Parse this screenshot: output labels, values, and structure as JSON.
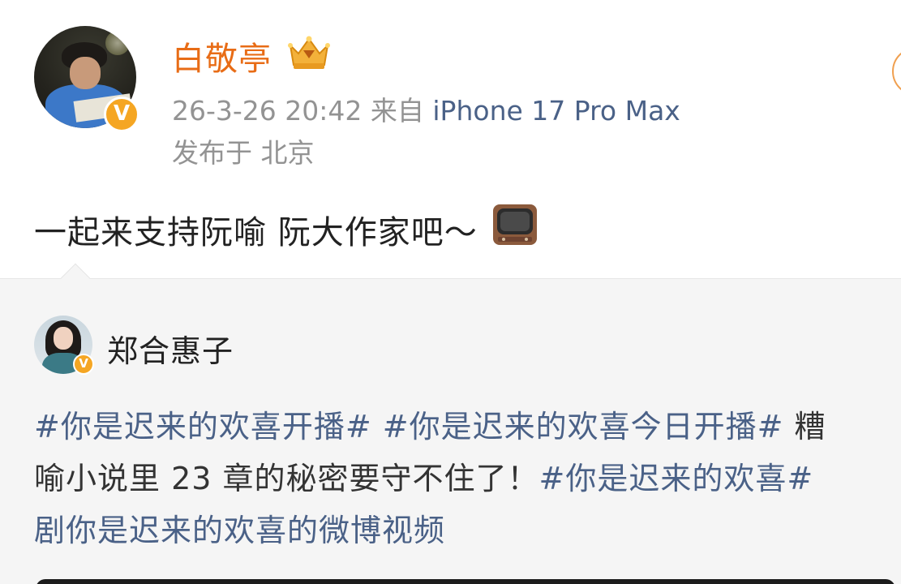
{
  "post": {
    "author": "白敬亭",
    "time": "26-3-26 20:42",
    "source_prefix": "来自",
    "device": "iPhone 17 Pro Max",
    "location": "发布于 北京",
    "text": "一起来支持阮喻 阮大作家吧～",
    "verified_badge": "V"
  },
  "repost": {
    "author": "郑合惠子",
    "verified_badge": "V",
    "line1": {
      "tag1": "#你是迟来的欢喜开播#",
      "sep1": " ",
      "tag2": "#你是迟来的欢喜今日开播#",
      "text1": " 糟"
    },
    "line2": {
      "text": "喻小说里 23 章的秘密要守不住了！",
      "tag": "#你是迟来的欢喜#"
    },
    "line3": {
      "text": "剧你是迟来的欢喜的微博视频"
    }
  },
  "colors": {
    "username": "#e86c16",
    "link": "#4a6187",
    "meta": "#939393",
    "badge": "#f5a623"
  }
}
